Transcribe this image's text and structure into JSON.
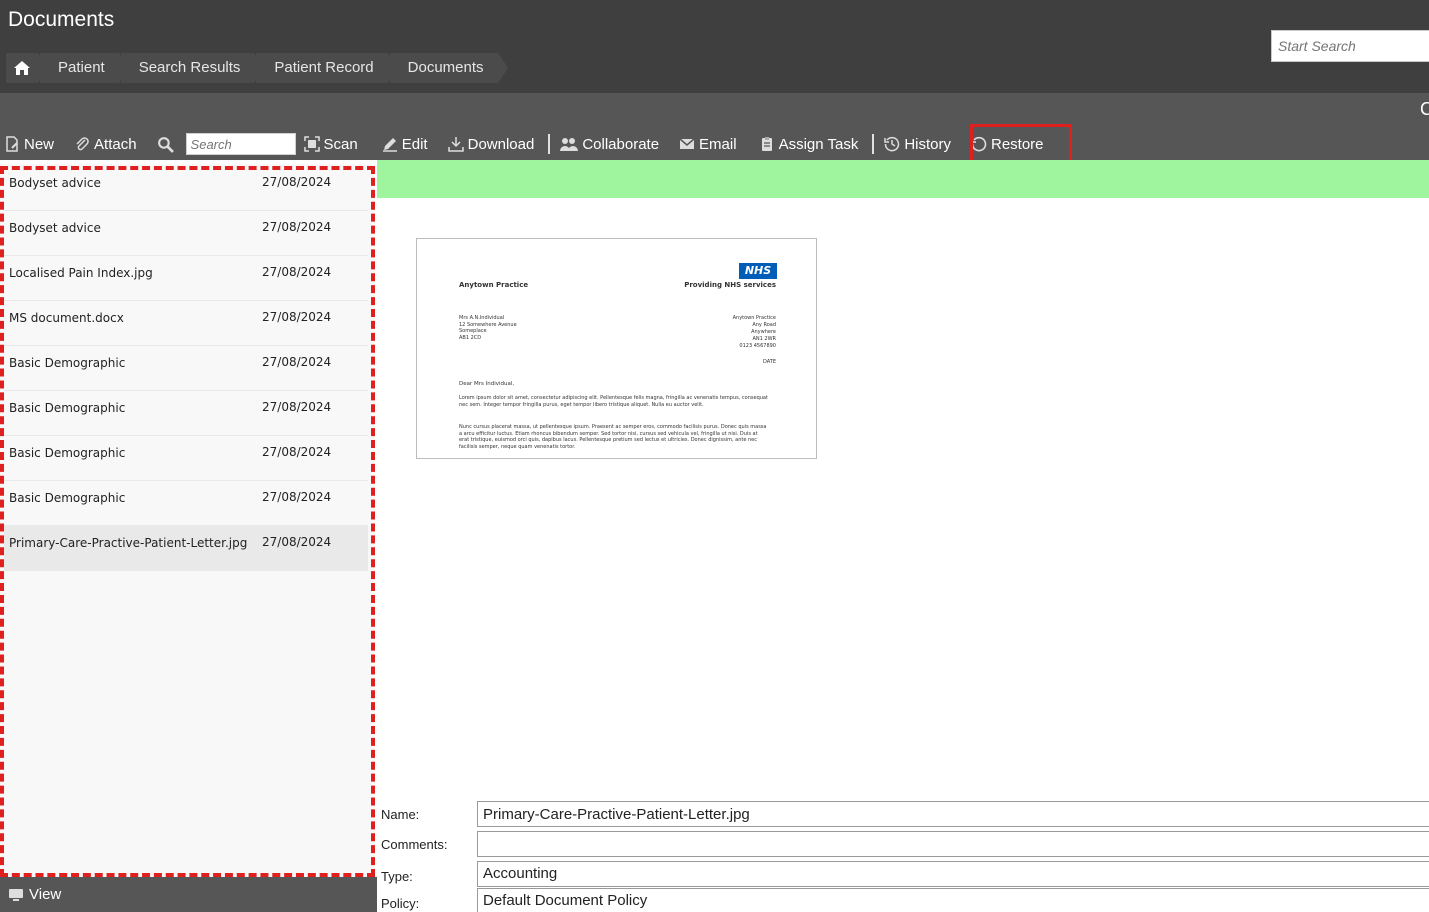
{
  "app": {
    "title": "Documents",
    "search_placeholder": "Start Search",
    "toolbar_right_glyph": "C"
  },
  "breadcrumb": {
    "home_icon": "home-icon",
    "items": [
      "Patient",
      "Search Results",
      "Patient Record",
      "Documents"
    ]
  },
  "toolbar": {
    "new_label": "New",
    "attach_label": "Attach",
    "search_placeholder": "Search",
    "scan_label": "Scan",
    "edit_label": "Edit",
    "download_label": "Download",
    "collaborate_label": "Collaborate",
    "email_label": "Email",
    "assign_task_label": "Assign Task",
    "history_label": "History",
    "restore_label": "Restore"
  },
  "documents": [
    {
      "name": "Bodyset advice",
      "date": "27/08/2024"
    },
    {
      "name": "Bodyset advice",
      "date": "27/08/2024"
    },
    {
      "name": "Localised Pain Index.jpg",
      "date": "27/08/2024"
    },
    {
      "name": "MS document.docx",
      "date": "27/08/2024"
    },
    {
      "name": "Basic Demographic",
      "date": "27/08/2024"
    },
    {
      "name": "Basic Demographic",
      "date": "27/08/2024"
    },
    {
      "name": "Basic Demographic",
      "date": "27/08/2024"
    },
    {
      "name": "Basic Demographic",
      "date": "27/08/2024"
    },
    {
      "name": "Primary-Care-Practive-Patient-Letter.jpg",
      "date": "27/08/2024",
      "selected": true
    }
  ],
  "view_label": "View",
  "preview": {
    "practice": "Anytown Practice",
    "nhs": "NHS",
    "providing": "Providing NHS services",
    "addr_left": "Mrs A.N.Individual\n12 Somewhere Avenue\nSomeplace\nAB1 2CD",
    "addr_right": "Anytown Practice\nAny Road\nAnywhere\nAN1 2WR\n0123 4567890",
    "date": "DATE",
    "dear": "Dear Mrs Individual,",
    "p1": "Lorem ipsum dolor sit amet, consectetur adipiscing elit. Pellentesque felis magna, fringilla ac venenatis tempus, consequat nec sem. Integer tempor fringilla purus, eget tempor libero tristique aliquet. Nulla eu auctor velit.",
    "p2": "Nunc cursus placerat massa, ut pellentesque ipsum. Praesent ac semper eros, commodo facilisis purus. Donec quis massa a arcu efficitur luctus. Etiam rhoncus bibendum semper. Sed tortor nisi, cursus sed vehicula vel, fringilla ut nisi. Duis at erat tristique, euismod orci quis, dapibus lacus. Pellentesque pretium sed lectus et ultricies. Donec dignissim, ante nec facilisis semper, neque quam venenatis tortor."
  },
  "form": {
    "name_label": "Name:",
    "name_value": "Primary-Care-Practive-Patient-Letter.jpg",
    "comments_label": "Comments:",
    "comments_value": "",
    "type_label": "Type:",
    "type_value": "Accounting",
    "policy_label": "Policy:",
    "policy_value": "Default Document Policy"
  },
  "colors": {
    "highlight_red": "#e01f1f",
    "green_bar": "#9ef59e",
    "header": "#3f3f3f",
    "toolbar": "#565656",
    "nhs_blue": "#005eb8"
  }
}
